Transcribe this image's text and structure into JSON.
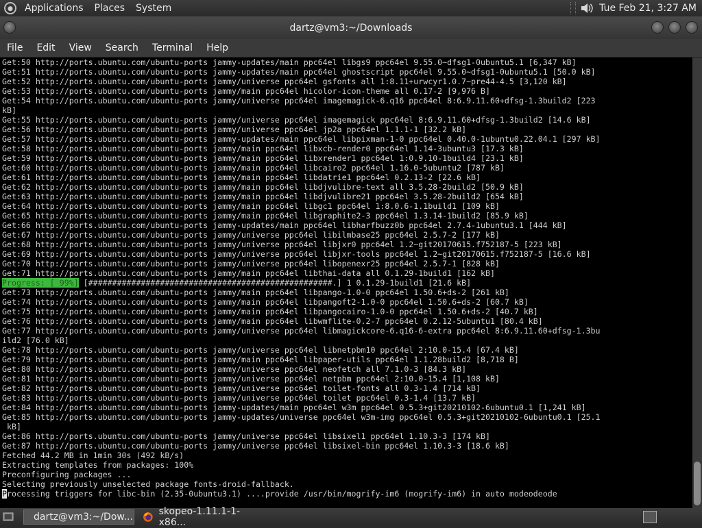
{
  "top_panel": {
    "menus": [
      "Applications",
      "Places",
      "System"
    ],
    "clock": "Tue Feb 21,  3:27 AM",
    "icons": [
      "distro-logo-icon",
      "volume-icon"
    ]
  },
  "window": {
    "title": "dartz@vm3:~/Downloads",
    "menu": [
      "File",
      "Edit",
      "View",
      "Search",
      "Terminal",
      "Help"
    ]
  },
  "terminal": {
    "lines_before_progress": [
      "Get:50 http://ports.ubuntu.com/ubuntu-ports jammy-updates/main ppc64el libgs9 ppc64el 9.55.0~dfsg1-0ubuntu5.1 [6,347 kB]",
      "Get:51 http://ports.ubuntu.com/ubuntu-ports jammy-updates/main ppc64el ghostscript ppc64el 9.55.0~dfsg1-0ubuntu5.1 [50.0 kB]",
      "Get:52 http://ports.ubuntu.com/ubuntu-ports jammy/universe ppc64el gsfonts all 1:8.11+urwcyr1.0.7~pre44-4.5 [3,120 kB]",
      "Get:53 http://ports.ubuntu.com/ubuntu-ports jammy/main ppc64el hicolor-icon-theme all 0.17-2 [9,976 B]",
      "Get:54 http://ports.ubuntu.com/ubuntu-ports jammy/universe ppc64el imagemagick-6.q16 ppc64el 8:6.9.11.60+dfsg-1.3build2 [223",
      "kB]",
      "Get:55 http://ports.ubuntu.com/ubuntu-ports jammy/universe ppc64el imagemagick ppc64el 8:6.9.11.60+dfsg-1.3build2 [14.6 kB]",
      "Get:56 http://ports.ubuntu.com/ubuntu-ports jammy/universe ppc64el jp2a ppc64el 1.1.1-1 [32.2 kB]",
      "Get:57 http://ports.ubuntu.com/ubuntu-ports jammy-updates/main ppc64el libpixman-1-0 ppc64el 0.40.0-1ubuntu0.22.04.1 [297 kB]",
      "Get:58 http://ports.ubuntu.com/ubuntu-ports jammy/main ppc64el libxcb-render0 ppc64el 1.14-3ubuntu3 [17.3 kB]",
      "Get:59 http://ports.ubuntu.com/ubuntu-ports jammy/main ppc64el libxrender1 ppc64el 1:0.9.10-1build4 [23.1 kB]",
      "Get:60 http://ports.ubuntu.com/ubuntu-ports jammy/main ppc64el libcairo2 ppc64el 1.16.0-5ubuntu2 [787 kB]",
      "Get:61 http://ports.ubuntu.com/ubuntu-ports jammy/main ppc64el libdatrie1 ppc64el 0.2.13-2 [22.6 kB]",
      "Get:62 http://ports.ubuntu.com/ubuntu-ports jammy/main ppc64el libdjvulibre-text all 3.5.28-2build2 [50.9 kB]",
      "Get:63 http://ports.ubuntu.com/ubuntu-ports jammy/main ppc64el libdjvulibre21 ppc64el 3.5.28-2build2 [654 kB]",
      "Get:64 http://ports.ubuntu.com/ubuntu-ports jammy/main ppc64el libgc1 ppc64el 1:8.0.6-1.1build1 [109 kB]",
      "Get:65 http://ports.ubuntu.com/ubuntu-ports jammy/main ppc64el libgraphite2-3 ppc64el 1.3.14-1build2 [85.9 kB]",
      "Get:66 http://ports.ubuntu.com/ubuntu-ports jammy-updates/main ppc64el libharfbuzz0b ppc64el 2.7.4-1ubuntu3.1 [444 kB]",
      "Get:67 http://ports.ubuntu.com/ubuntu-ports jammy/universe ppc64el libilmbase25 ppc64el 2.5.7-2 [177 kB]",
      "Get:68 http://ports.ubuntu.com/ubuntu-ports jammy/universe ppc64el libjxr0 ppc64el 1.2~git20170615.f752187-5 [223 kB]",
      "Get:69 http://ports.ubuntu.com/ubuntu-ports jammy/universe ppc64el libjxr-tools ppc64el 1.2~git20170615.f752187-5 [16.6 kB]",
      "Get:70 http://ports.ubuntu.com/ubuntu-ports jammy/universe ppc64el libopenexr25 ppc64el 2.5.7-1 [828 kB]",
      "Get:71 http://ports.ubuntu.com/ubuntu-ports jammy/main ppc64el libthai-data all 0.1.29-1build1 [162 kB]"
    ],
    "progress_label": "Progress: [ 99%]",
    "progress_rest": " [###################################################.] 1 0.1.29-1build1 [21.6 kB]",
    "lines_after_progress": [
      "Get:73 http://ports.ubuntu.com/ubuntu-ports jammy/main ppc64el libpango-1.0-0 ppc64el 1.50.6+ds-2 [261 kB]",
      "Get:74 http://ports.ubuntu.com/ubuntu-ports jammy/main ppc64el libpangoft2-1.0-0 ppc64el 1.50.6+ds-2 [60.7 kB]",
      "Get:75 http://ports.ubuntu.com/ubuntu-ports jammy/main ppc64el libpangocairo-1.0-0 ppc64el 1.50.6+ds-2 [40.7 kB]",
      "Get:76 http://ports.ubuntu.com/ubuntu-ports jammy/main ppc64el libwmflite-0.2-7 ppc64el 0.2.12-5ubuntu1 [80.4 kB]",
      "Get:77 http://ports.ubuntu.com/ubuntu-ports jammy/universe ppc64el libmagickcore-6.q16-6-extra ppc64el 8:6.9.11.60+dfsg-1.3bu",
      "ild2 [76.0 kB]",
      "Get:78 http://ports.ubuntu.com/ubuntu-ports jammy/universe ppc64el libnetpbm10 ppc64el 2:10.0-15.4 [67.4 kB]",
      "Get:79 http://ports.ubuntu.com/ubuntu-ports jammy/main ppc64el libpaper-utils ppc64el 1.1.28build2 [8,718 B]",
      "Get:80 http://ports.ubuntu.com/ubuntu-ports jammy/universe ppc64el neofetch all 7.1.0-3 [84.3 kB]",
      "Get:81 http://ports.ubuntu.com/ubuntu-ports jammy/universe ppc64el netpbm ppc64el 2:10.0-15.4 [1,108 kB]",
      "Get:82 http://ports.ubuntu.com/ubuntu-ports jammy/universe ppc64el toilet-fonts all 0.3-1.4 [714 kB]",
      "Get:83 http://ports.ubuntu.com/ubuntu-ports jammy/universe ppc64el toilet ppc64el 0.3-1.4 [13.7 kB]",
      "Get:84 http://ports.ubuntu.com/ubuntu-ports jammy-updates/main ppc64el w3m ppc64el 0.5.3+git20210102-6ubuntu0.1 [1,241 kB]",
      "Get:85 http://ports.ubuntu.com/ubuntu-ports jammy-updates/universe ppc64el w3m-img ppc64el 0.5.3+git20210102-6ubuntu0.1 [25.1",
      " kB]",
      "Get:86 http://ports.ubuntu.com/ubuntu-ports jammy/universe ppc64el libsixel1 ppc64el 1.10.3-3 [174 kB]",
      "Get:87 http://ports.ubuntu.com/ubuntu-ports jammy/universe ppc64el libsixel-bin ppc64el 1.10.3-3 [18.6 kB]",
      "Fetched 44.2 MB in 1min 30s (492 kB/s)",
      "Extracting templates from packages: 100%",
      "Preconfiguring packages ...",
      "Selecting previously unselected package fonts-droid-fallback."
    ],
    "last_line_cursor_char": "P",
    "last_line_rest": "rocessing triggers for libc-bin (2.35-0ubuntu3.1) ....provide /usr/bin/mogrify-im6 (mogrify-im6) in auto modeodeode"
  },
  "taskbar": {
    "items": [
      {
        "label": "dartz@vm3:~/Dow...",
        "icon": "terminal-icon"
      },
      {
        "label": "skopeo-1.11.1-1-x86...",
        "icon": "firefox-icon"
      }
    ]
  },
  "colors": {
    "terminal_bg": "#000000",
    "terminal_fg": "#d0d0d0",
    "progress_bg": "#3cb83c"
  }
}
